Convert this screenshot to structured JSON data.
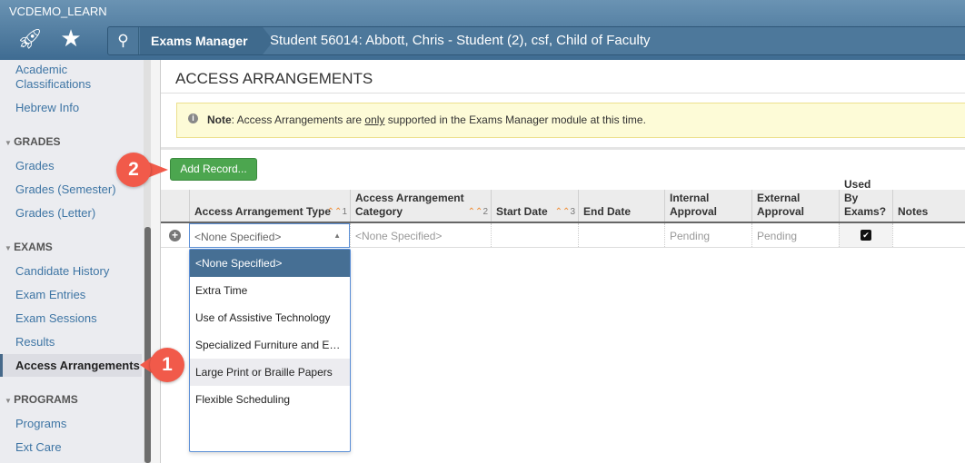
{
  "app_title": "VCDEMO_LEARN",
  "header": {
    "module": "Exams Manager",
    "student": "Student 56014: Abbott, Chris - Student (2), csf, Child of Faculty"
  },
  "sidebar": {
    "items": [
      "Academic",
      "Classifications",
      "Hebrew Info",
      "Grades",
      "Grades (Semester)",
      "Grades (Letter)",
      "Candidate History",
      "Exam Entries",
      "Exam Sessions",
      "Results",
      "Access Arrangements",
      "Programs",
      "Ext Care"
    ],
    "sections": [
      "GRADES",
      "EXAMS",
      "PROGRAMS"
    ]
  },
  "page": {
    "title": "ACCESS ARRANGEMENTS",
    "note": {
      "label": "Note",
      "text1": ": Access Arrangements are ",
      "emph": "only",
      "text2": " supported in the Exams Manager module at this time."
    },
    "add_button": "Add Record..."
  },
  "table": {
    "headers": [
      "Access Arrangement Type",
      "Access Arrangement Category",
      "Start Date",
      "End Date",
      "Internal Approval",
      "External Approval",
      "Used By Exams?",
      "Notes"
    ],
    "sort_orders": [
      "1",
      "2",
      "3"
    ],
    "row": {
      "type": "<None Specified>",
      "category": "<None Specified>",
      "start": "",
      "end": "",
      "internal": "Pending",
      "external": "Pending",
      "used_by_exams": true,
      "notes": ""
    }
  },
  "dropdown": {
    "options": [
      "<None Specified>",
      "Extra Time",
      "Use of Assistive Technology",
      "Specialized Furniture and Equipment",
      "Large Print or Braille Papers",
      "Flexible Scheduling"
    ],
    "selected": 0,
    "hovered": 4
  },
  "callouts": [
    "1",
    "2"
  ],
  "colors": {
    "header": "#4a7699",
    "add": "#4ca64f",
    "callout": "#f15a4a",
    "selected": "#466f94"
  }
}
